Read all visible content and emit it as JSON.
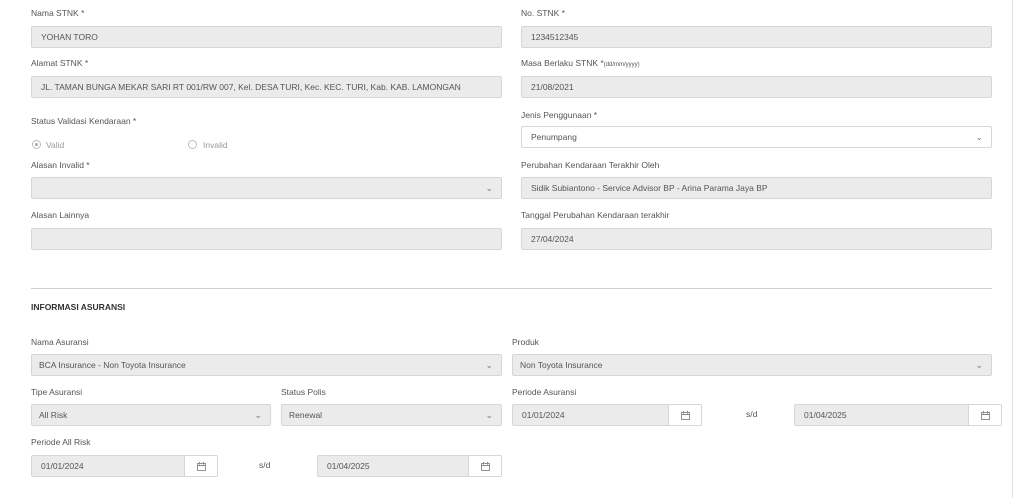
{
  "stnk": {
    "nama_label": "Nama STNK *",
    "nama_value": "YOHAN TORO",
    "no_label": "No. STNK *",
    "no_value": "1234512345",
    "alamat_label": "Alamat STNK *",
    "alamat_value": "JL. TAMAN BUNGA MEKAR SARI RT 001/RW 007, Kel. DESA TURI, Kec. KEC. TURI, Kab. KAB. LAMONGAN",
    "masa_label": "Masa Berlaku STNK *",
    "masa_hint": "(dd/mm/yyyy)",
    "masa_value": "21/08/2021",
    "status_label": "Status Validasi Kendaraan *",
    "status_options": [
      "Valid",
      "Invalid"
    ],
    "status_selected": "Valid",
    "jenis_label": "Jenis Penggunaan *",
    "jenis_value": "Penumpang",
    "alasan_invalid_label": "Alasan Invalid *",
    "alasan_invalid_value": "",
    "perubahan_label": "Perubahan Kendaraan Terakhir Oleh",
    "perubahan_value": "Sidik Subiantono - Service Advisor BP - Arina Parama Jaya BP",
    "alasan_lain_label": "Alasan Lainnya",
    "alasan_lain_value": "",
    "tanggal_label": "Tanggal Perubahan Kendaraan terakhir",
    "tanggal_value": "27/04/2024"
  },
  "asuransi": {
    "section_title": "INFORMASI ASURANSI",
    "nama_label": "Nama Asuransi",
    "nama_value": "BCA Insurance - Non Toyota Insurance",
    "produk_label": "Produk",
    "produk_value": "Non Toyota Insurance",
    "tipe_label": "Tipe Asuransi",
    "tipe_value": "All Risk",
    "status_polis_label": "Status Polis",
    "status_polis_value": "Renewal",
    "periode_label": "Periode Asuransi",
    "periode_start": "01/01/2024",
    "periode_end": "01/04/2025",
    "periode_ar_label": "Periode All Risk",
    "periode_ar_start": "01/01/2024",
    "periode_ar_end": "01/04/2025",
    "sd_text": "s/d"
  }
}
